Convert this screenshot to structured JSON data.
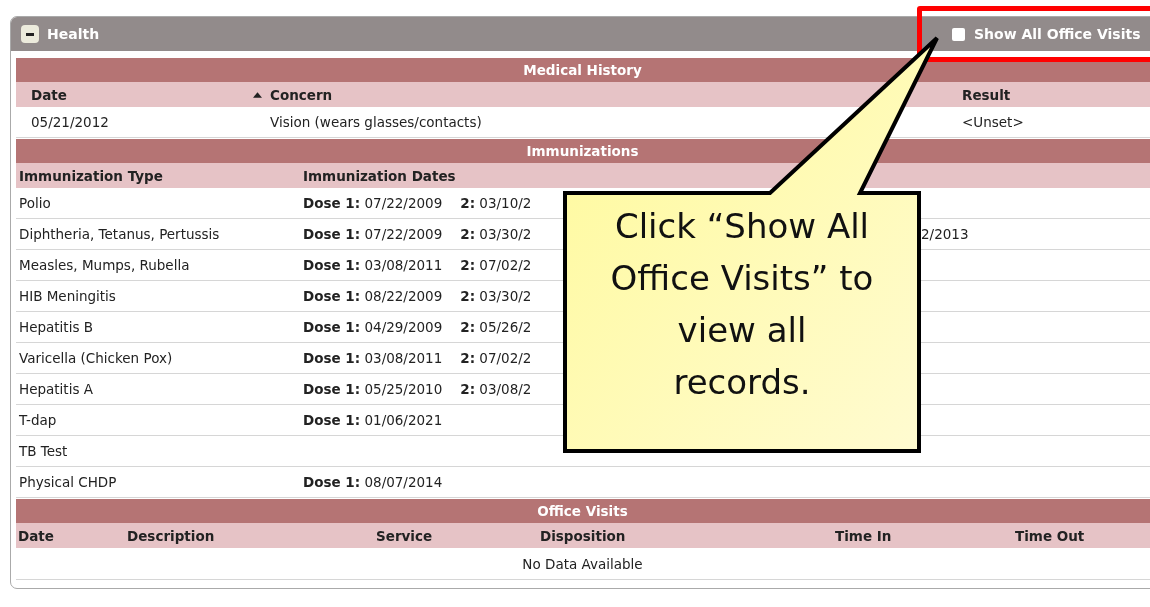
{
  "panel": {
    "title": "Health",
    "collapsed": false,
    "show_all_office_visits": {
      "label": "Show All Office Visits",
      "checked": false
    }
  },
  "medical_history": {
    "title": "Medical History",
    "columns": [
      {
        "label": "Date",
        "sorted": false
      },
      {
        "label": "Concern",
        "sorted": true
      },
      {
        "label": "Result",
        "sorted": false
      }
    ],
    "rows": [
      {
        "date": "05/21/2012",
        "concern": "Vision (wears glasses/contacts)",
        "result": "<Unset>"
      }
    ]
  },
  "immunizations": {
    "title": "Immunizations",
    "columns": [
      "Immunization Type",
      "Immunization Dates"
    ],
    "rows": [
      {
        "type": "Polio",
        "doses": [
          {
            "label": "Dose 1:",
            "date": "07/22/2009"
          },
          {
            "label": "2:",
            "date": "03/10/2"
          }
        ]
      },
      {
        "type": "Diphtheria, Tetanus, Pertussis",
        "doses": [
          {
            "label": "Dose 1:",
            "date": "07/22/2009"
          },
          {
            "label": "2:",
            "date": "03/30/2"
          }
        ],
        "column_3": "2/2013"
      },
      {
        "type": "Measles, Mumps, Rubella",
        "doses": [
          {
            "label": "Dose 1:",
            "date": "03/08/2011"
          },
          {
            "label": "2:",
            "date": "07/02/2"
          }
        ]
      },
      {
        "type": "HIB Meningitis",
        "doses": [
          {
            "label": "Dose 1:",
            "date": "08/22/2009"
          },
          {
            "label": "2:",
            "date": "03/30/2"
          }
        ]
      },
      {
        "type": "Hepatitis B",
        "doses": [
          {
            "label": "Dose 1:",
            "date": "04/29/2009"
          },
          {
            "label": "2:",
            "date": "05/26/2"
          }
        ]
      },
      {
        "type": "Varicella (Chicken Pox)",
        "doses": [
          {
            "label": "Dose 1:",
            "date": "03/08/2011"
          },
          {
            "label": "2:",
            "date": "07/02/2"
          }
        ]
      },
      {
        "type": "Hepatitis A",
        "doses": [
          {
            "label": "Dose 1:",
            "date": "05/25/2010"
          },
          {
            "label": "2:",
            "date": "03/08/2"
          }
        ]
      },
      {
        "type": "T-dap",
        "doses": [
          {
            "label": "Dose 1:",
            "date": "01/06/2021"
          }
        ]
      },
      {
        "type": "TB Test",
        "doses": []
      },
      {
        "type": "Physical CHDP",
        "doses": [
          {
            "label": "Dose 1:",
            "date": "08/07/2014"
          }
        ]
      }
    ]
  },
  "office_visits": {
    "title": "Office Visits",
    "columns": [
      "Date",
      "Description",
      "Service",
      "Disposition",
      "Time In",
      "Time Out"
    ],
    "empty_text": "No Data Available"
  },
  "callout": {
    "text": "Click “Show All\nOffice Visits” to\nview all\nrecords."
  }
}
